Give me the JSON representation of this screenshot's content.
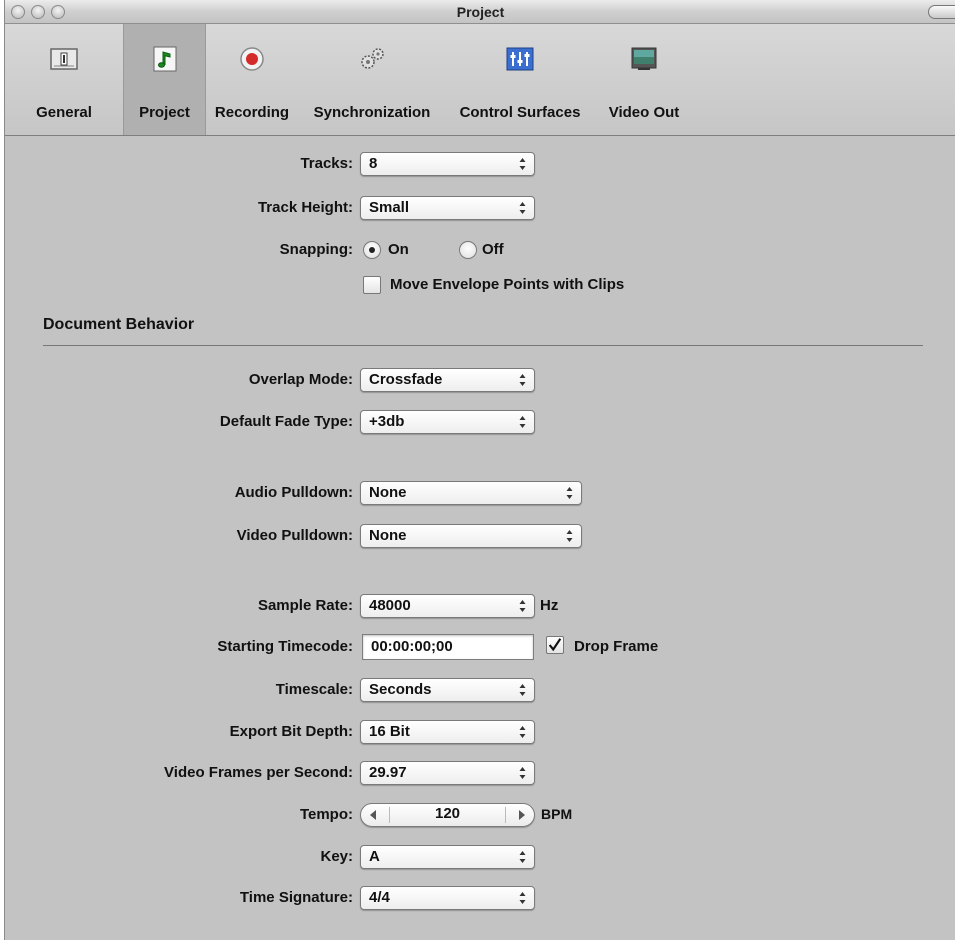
{
  "window": {
    "title": "Project"
  },
  "toolbar": {
    "items": [
      {
        "label": "General",
        "icon": "general-icon"
      },
      {
        "label": "Project",
        "icon": "music-note-icon",
        "selected": true
      },
      {
        "label": "Recording",
        "icon": "record-icon"
      },
      {
        "label": "Synchronization",
        "icon": "gears-icon"
      },
      {
        "label": "Control Surfaces",
        "icon": "mixer-icon"
      },
      {
        "label": "Video Out",
        "icon": "monitor-icon"
      }
    ]
  },
  "settings": {
    "tracks": {
      "label": "Tracks:",
      "value": "8"
    },
    "track_height": {
      "label": "Track Height:",
      "value": "Small"
    },
    "snapping": {
      "label": "Snapping:",
      "on_label": "On",
      "off_label": "Off",
      "selected": "On"
    },
    "move_envelope": {
      "label": "Move Envelope Points with Clips",
      "checked": false
    }
  },
  "document_behavior": {
    "section_title": "Document Behavior",
    "overlap_mode": {
      "label": "Overlap Mode:",
      "value": "Crossfade"
    },
    "default_fade_type": {
      "label": "Default Fade Type:",
      "value": "+3db"
    },
    "audio_pulldown": {
      "label": "Audio Pulldown:",
      "value": "None"
    },
    "video_pulldown": {
      "label": "Video Pulldown:",
      "value": "None"
    },
    "sample_rate": {
      "label": "Sample Rate:",
      "value": "48000",
      "unit": "Hz"
    },
    "starting_timecode": {
      "label": "Starting Timecode:",
      "value": "00:00:00;00",
      "drop_frame_label": "Drop Frame",
      "drop_frame_checked": true
    },
    "timescale": {
      "label": "Timescale:",
      "value": "Seconds"
    },
    "export_bit_depth": {
      "label": "Export Bit Depth:",
      "value": "16 Bit"
    },
    "video_fps": {
      "label": "Video Frames per Second:",
      "value": "29.97"
    },
    "tempo": {
      "label": "Tempo:",
      "value": "120",
      "unit": "BPM"
    },
    "key": {
      "label": "Key:",
      "value": "A"
    },
    "time_signature": {
      "label": "Time Signature:",
      "value": "4/4"
    }
  }
}
